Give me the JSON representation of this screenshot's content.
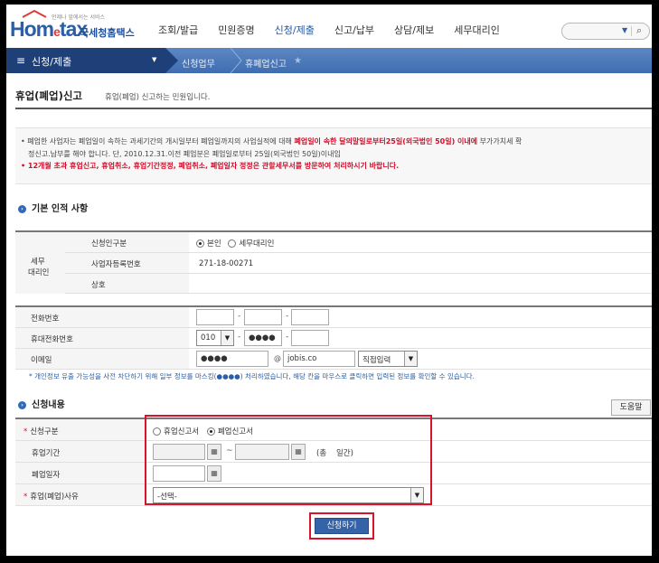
{
  "header": {
    "logo_tagline": "언제나 앞에서는 서비스",
    "logo_word_a": "Hom",
    "logo_word_e": "e",
    "logo_word_b": "tax",
    "logo_kr": "국세청홈택스",
    "nav": [
      "조회/발급",
      "민원증명",
      "신청/제출",
      "신고/납부",
      "상담/제보",
      "세무대리인"
    ],
    "nav_active": "신청/제출"
  },
  "menubar": {
    "menu_label": "신청/제출",
    "crumb1": "신청업무",
    "crumb2": "휴폐업신고"
  },
  "page": {
    "title": "휴업(폐업)신고",
    "desc": "휴업(폐업) 신고하는 민원입니다."
  },
  "notice": {
    "line1_a": "• 폐업한 사업자는 폐업일이 속하는 과세기간의 개시일부터 폐업일까지의 사업실적에 대해 ",
    "line1_red": "폐업일이 속한 달의말일로부터25일(외국법인 50일) 이내에",
    "line1_b": " 부가가치세 확",
    "line2": "정신고.납부를 해야 합니다. 단, 2010.12.31.이전 폐업분은 폐업일로부터 25일(외국법인 50일)이내임",
    "line3": "• 12개월 초과 휴업신고, 휴업취소, 휴업기간정정, 폐업취소, 폐업일자 정정은 관할세무서를 방문하여 처리하시기 바랍니다."
  },
  "basic": {
    "section_title": "기본 인적 사항",
    "agent_label_1": "세무",
    "agent_label_2": "대리인",
    "applicant_type_label": "신청인구분",
    "applicant_opt1": "본인",
    "applicant_opt2": "세무대리인",
    "bizno_label": "사업자등록번호",
    "bizno_value": "271-18-00271",
    "name_label": "상호",
    "phone_label": "전화번호",
    "mobile_label": "휴대전화번호",
    "mobile_prefix": "010",
    "mobile_mid": "●●●●",
    "email_label": "이메일",
    "email_id": "●●●●",
    "email_at": "@",
    "email_domain": "jobis.co",
    "email_select": "직접입력",
    "privacy_note": "* 개인정보 유출 가능성을 사전 차단하기 위해 일부 정보를 마스킹(●●●●) 처리하였습니다, 해당 칸을 마우스로 클릭하면 입력된 정보를 확인할 수 있습니다."
  },
  "apply": {
    "section_title": "신청내용",
    "help_label": "도움말",
    "type_label": "신청구분",
    "type_opt1": "휴업신고서",
    "type_opt2": "폐업신고서",
    "period_label": "휴업기간",
    "period_tilde": "~",
    "period_total": "(총    일간)",
    "close_date_label": "폐업일자",
    "reason_label": "휴업(폐업)사유",
    "reason_value": "-선택-",
    "submit_label": "신청하기"
  },
  "colors": {
    "brand_blue": "#2a5fa8",
    "menubar_dark": "#1f3f78",
    "highlight_red": "#d8132a"
  }
}
